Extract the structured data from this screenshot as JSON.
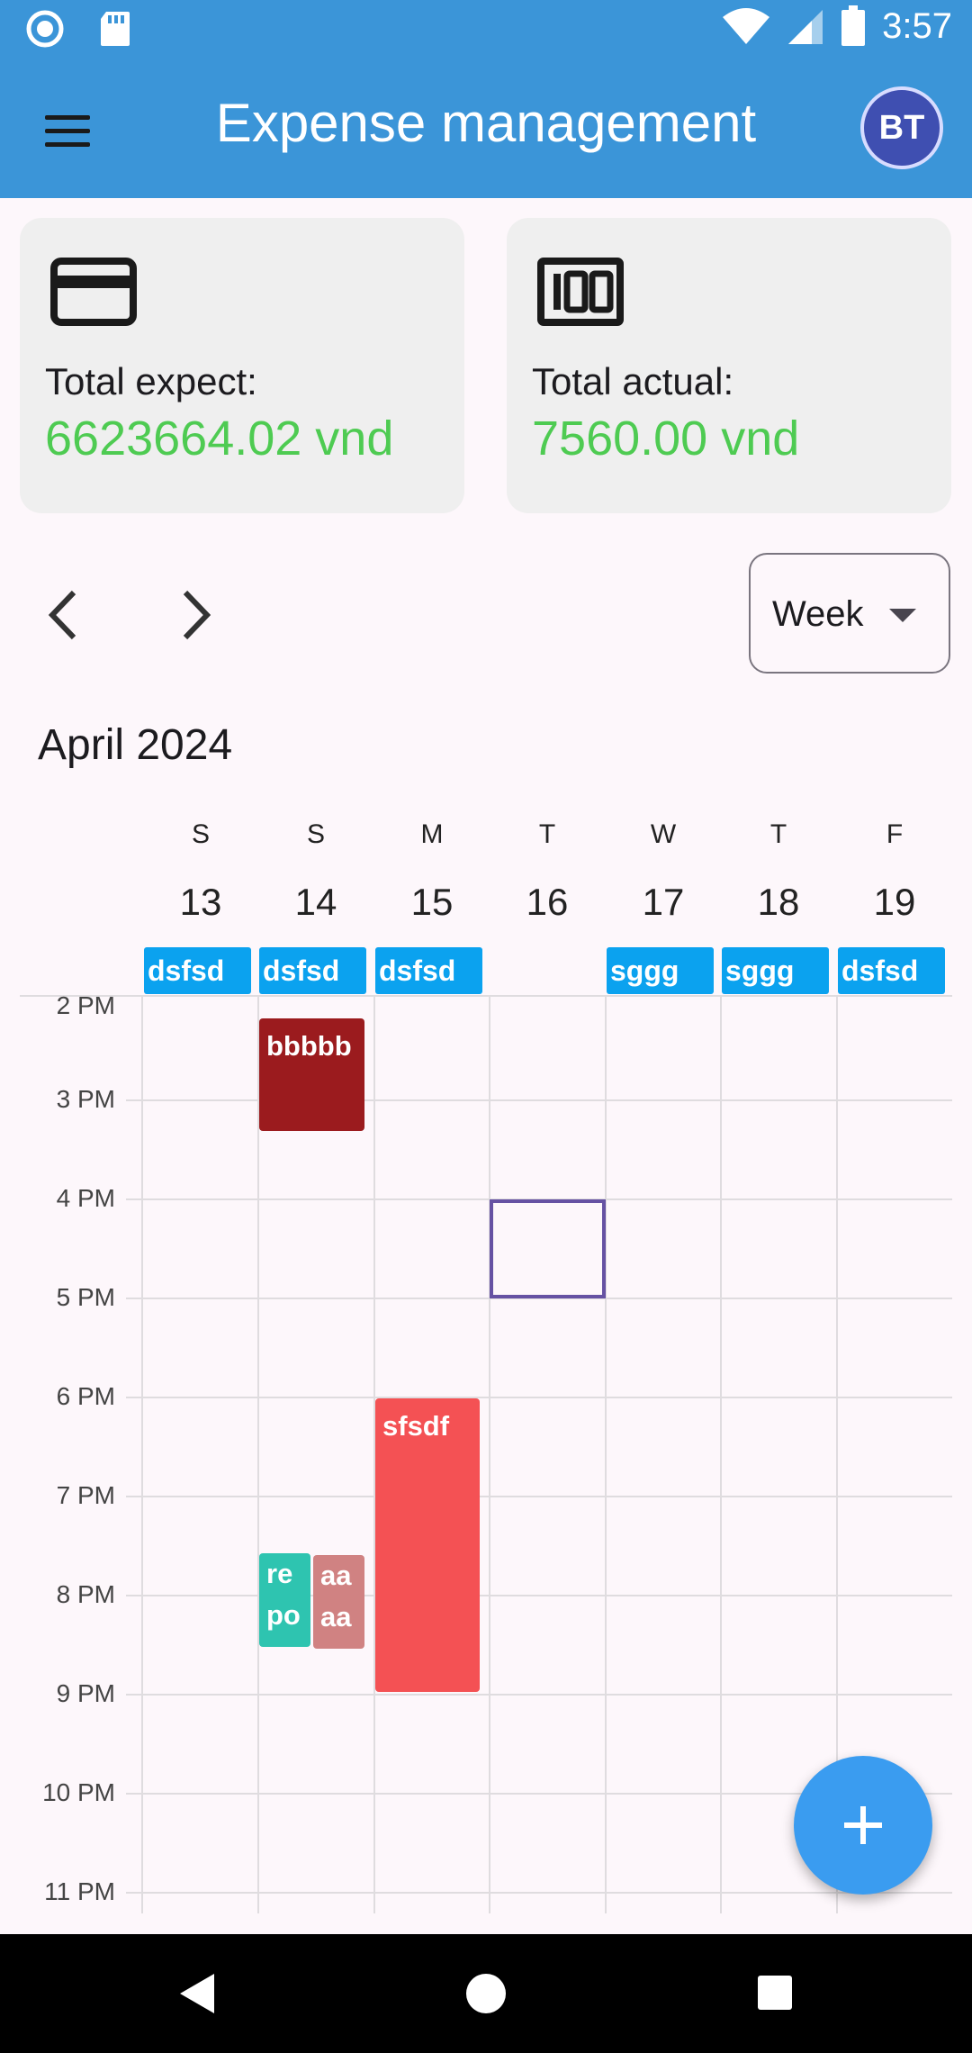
{
  "status_bar": {
    "time": "3:57"
  },
  "app_bar": {
    "title": "Expense management",
    "avatar_initials": "BT"
  },
  "summary": {
    "expected": {
      "label": "Total expect:",
      "value": "6623664.02 vnd",
      "icon": "credit-card-icon"
    },
    "actual": {
      "label": "Total actual:",
      "value": "7560.00 vnd",
      "icon": "100-icon"
    }
  },
  "calendar": {
    "view": "Week",
    "month_title": "April 2024",
    "days": [
      {
        "letter": "S",
        "num": "13"
      },
      {
        "letter": "S",
        "num": "14"
      },
      {
        "letter": "M",
        "num": "15"
      },
      {
        "letter": "T",
        "num": "16"
      },
      {
        "letter": "W",
        "num": "17"
      },
      {
        "letter": "T",
        "num": "18"
      },
      {
        "letter": "F",
        "num": "19"
      }
    ],
    "all_day_events": [
      "dsfsd",
      "dsfsd",
      "dsfsd",
      "sggg",
      "sggg",
      "dsfsd"
    ],
    "time_labels": [
      "2 PM",
      "3 PM",
      "4 PM",
      "5 PM",
      "6 PM",
      "7 PM",
      "8 PM",
      "9 PM",
      "10 PM",
      "11 PM"
    ],
    "appointments": [
      {
        "title": "bbbbb",
        "color": "#9b1b1e"
      },
      {
        "title": "sfsdf",
        "color": "#f45154"
      },
      {
        "title_line1": "re",
        "title_line2": "po",
        "color": "#2ec4b0"
      },
      {
        "title_line1": "aa",
        "title_line2": "aa",
        "color": "#d08282"
      }
    ]
  },
  "colors": {
    "primary": "#3b95d8",
    "accent_value": "#4ecb52",
    "all_day": "#0ba2ef",
    "fab": "#3a9cf0"
  }
}
